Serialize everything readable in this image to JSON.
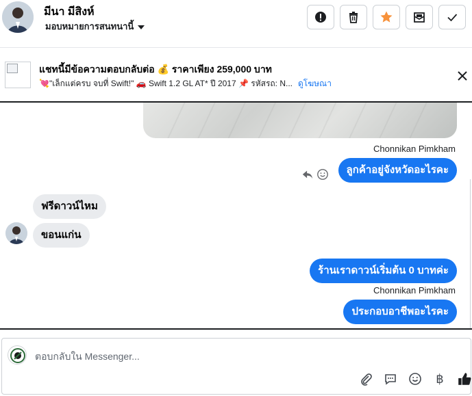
{
  "header": {
    "contact_name": "มีนา มีสิงห์",
    "assign_label": "มอบหมายการสนทนานี้",
    "actions": [
      {
        "name": "spam-button",
        "icon": "alert-icon"
      },
      {
        "name": "delete-button",
        "icon": "trash-icon"
      },
      {
        "name": "star-button",
        "icon": "star-icon",
        "color": "#f7923b"
      },
      {
        "name": "mark-unread-button",
        "icon": "mail-icon"
      },
      {
        "name": "done-button",
        "icon": "check-icon"
      }
    ]
  },
  "ad": {
    "title": "แชทนี้มีข้อความตอบกลับต่อ 💰 ราคาเพียง 259,000 บาท",
    "subtitle": "💘\"เล็กแต่ครบ จบที่ Swift!\" 🚗 Swift 1.2 GL AT* ปี 2017 📌 รหัสรถ: N...",
    "link": "ดูโฆษณา"
  },
  "messages": [
    {
      "sender": "Chonnikan Pimkham",
      "direction": "out",
      "text": "ลูกค้าอยู่จังหวัดอะไรคะ"
    },
    {
      "direction": "in",
      "text": "ฟรีดาวน์ไหม"
    },
    {
      "direction": "in",
      "text": "ขอนแก่น"
    },
    {
      "direction": "out",
      "text": "ร้านเราดาวน์เริ่มต้น 0 บาทค่ะ"
    },
    {
      "sender": "Chonnikan Pimkham",
      "direction": "out",
      "text": "ประกอบอาชีพอะไรคะ"
    }
  ],
  "composer": {
    "placeholder": "ตอบกลับใน Messenger...",
    "tools": [
      "attach-icon",
      "quick-reply-icon",
      "emoji-icon",
      "payment-icon",
      "like-icon"
    ]
  },
  "colors": {
    "accent": "#1877f2",
    "incoming_bubble": "#e9ebee",
    "star": "#f7923b"
  }
}
